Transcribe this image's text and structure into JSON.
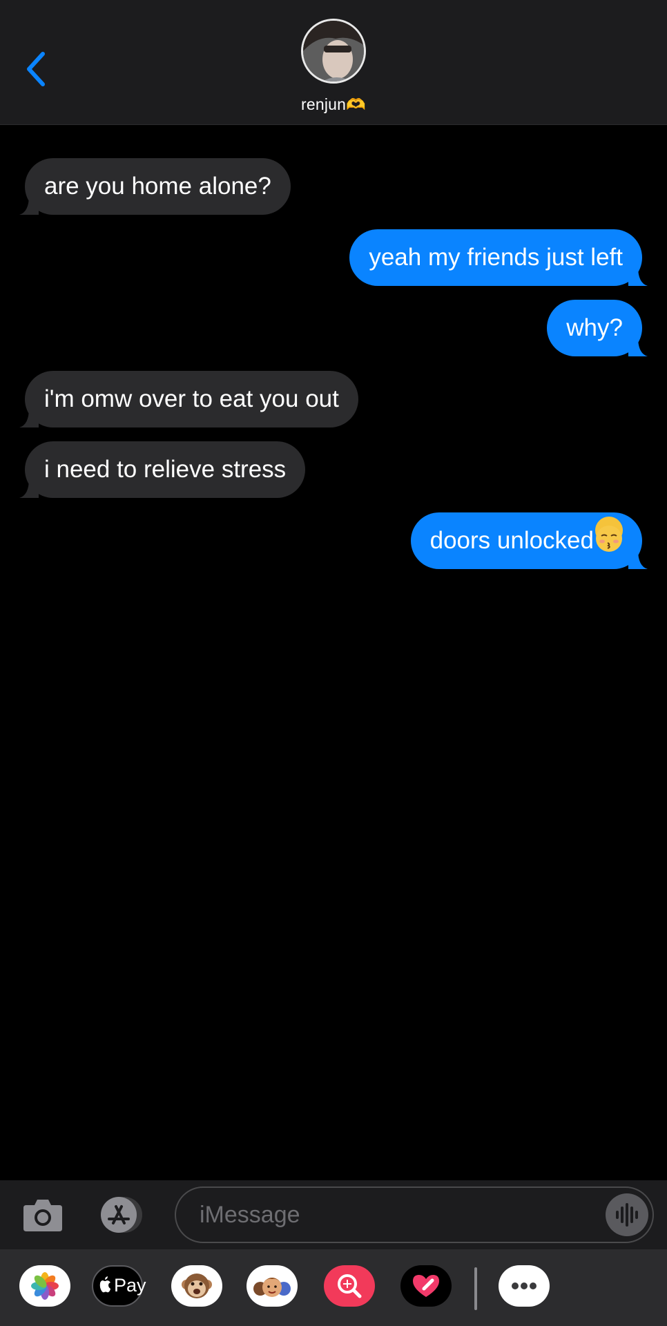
{
  "header": {
    "contact_name": "renjun🫶"
  },
  "messages": [
    {
      "direction": "in",
      "text": "are you home alone?"
    },
    {
      "direction": "out",
      "text": "yeah my friends just left"
    },
    {
      "direction": "out",
      "text": "why?"
    },
    {
      "direction": "in",
      "text": "i'm omw over to eat you out"
    },
    {
      "direction": "in",
      "text": "i need to relieve stress"
    },
    {
      "direction": "out",
      "text": "doors unlocked"
    }
  ],
  "input": {
    "placeholder": "iMessage"
  },
  "drawer": {
    "apple_pay_label": "Pay",
    "apps": [
      "photos-app",
      "apple-pay-app",
      "animoji-app",
      "memoji-app",
      "image-search-app",
      "digital-touch-app",
      "more-apps"
    ]
  },
  "colors": {
    "outgoing_bubble": "#0a84ff",
    "incoming_bubble": "#2b2b2d",
    "background": "#000000"
  }
}
